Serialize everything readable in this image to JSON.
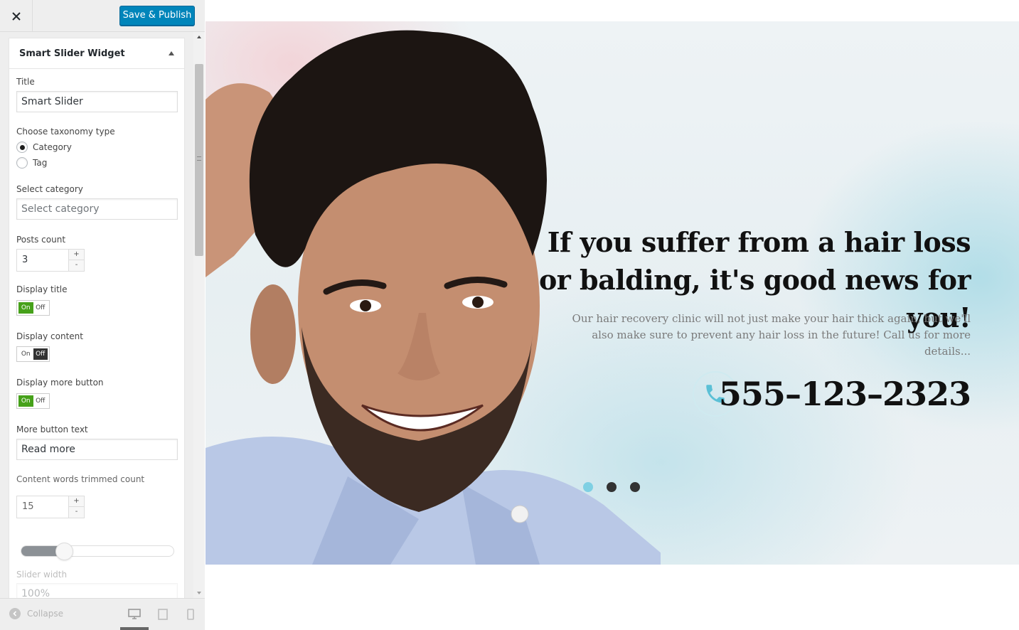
{
  "header": {
    "close_label": "×",
    "publish_label": "Save & Publish"
  },
  "widget": {
    "title": "Smart Slider Widget",
    "fields": {
      "title_label": "Title",
      "title_value": "Smart Slider",
      "taxonomy_label": "Choose taxonomy type",
      "taxonomy_options": [
        "Category",
        "Tag"
      ],
      "taxonomy_selected": "Category",
      "category_label": "Select category",
      "category_placeholder": "Select category",
      "posts_count_label": "Posts count",
      "posts_count_value": "3",
      "display_title_label": "Display title",
      "display_title": "On",
      "display_content_label": "Display content",
      "display_content": "Off",
      "display_more_label": "Display more button",
      "display_more": "On",
      "more_text_label": "More button text",
      "more_text_value": "Read more",
      "trim_label": "Content words trimmed count",
      "trim_value": "15",
      "slider_level_fraction": 0.24,
      "width_label": "Slider width",
      "width_value": "100%"
    },
    "toggle_on": "On",
    "toggle_off": "Off",
    "spin_up": "+",
    "spin_down": "-"
  },
  "footer": {
    "collapse_label": "Collapse",
    "devices": [
      "desktop-icon",
      "tablet-icon",
      "mobile-icon"
    ]
  },
  "slide": {
    "headline": "If you suffer from a hair loss or balding, it's good news for you!",
    "subtext": "Our hair recovery clinic will not just make your hair thick again, but we'll also make sure to prevent any hair loss in the future!  Call us for more details...",
    "phone": "555–123–2323",
    "dots": 3,
    "active_dot": 0
  },
  "colors": {
    "accent": "#0085ba",
    "toggle_on": "#46a11a",
    "toggle_off": "#333333",
    "dot_active": "#7fd0e3"
  }
}
